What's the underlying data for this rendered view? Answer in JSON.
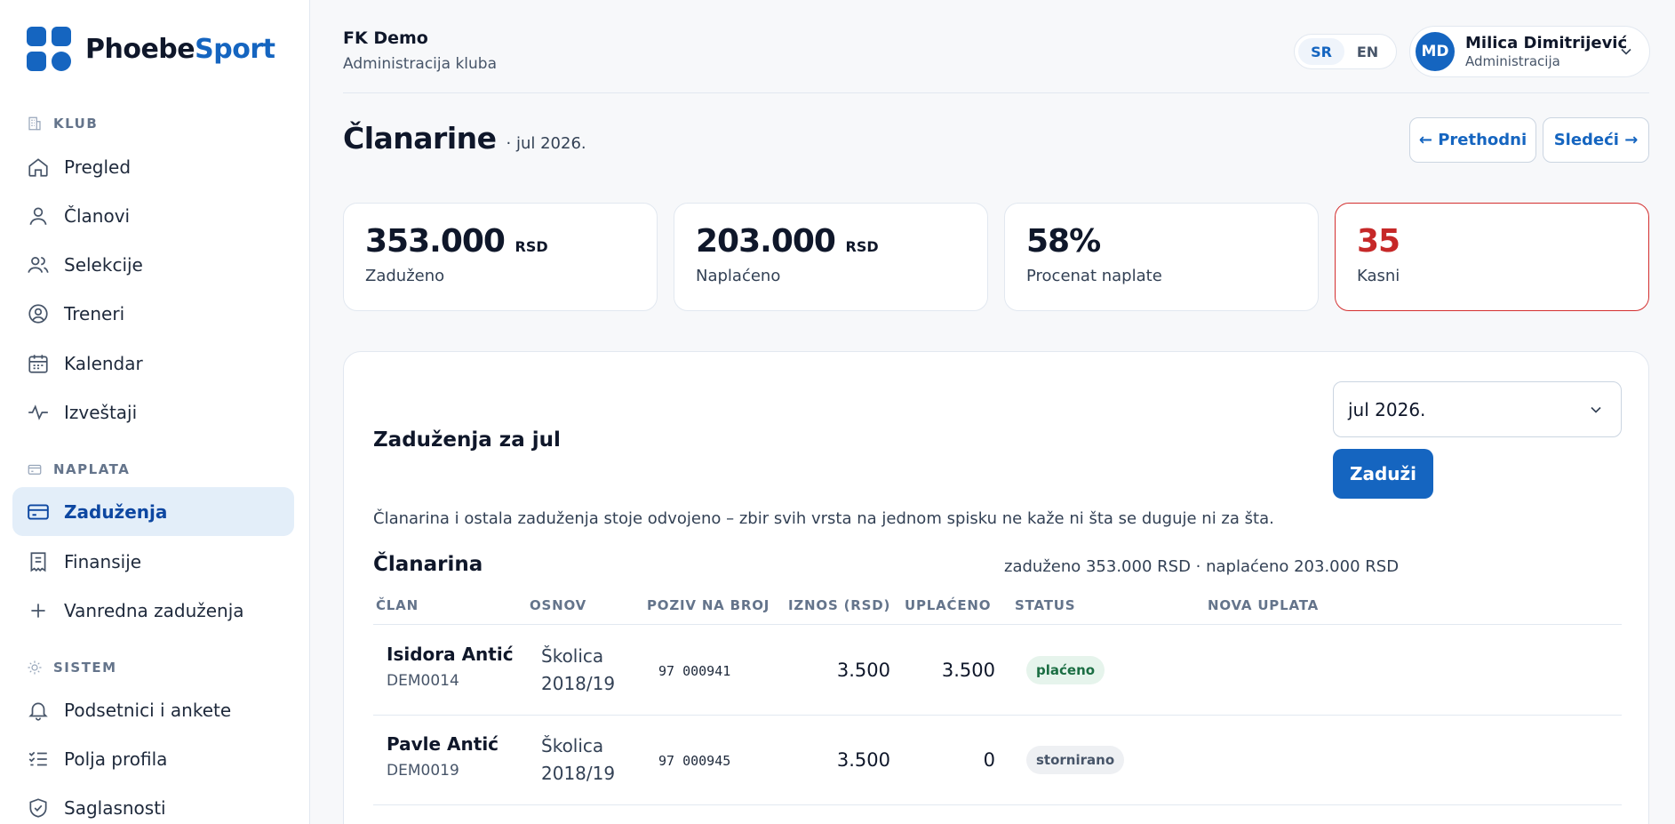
{
  "brand": {
    "name_part1": "Phoebe",
    "name_part2": "Sport",
    "color": "#1565c0"
  },
  "sidebar": {
    "sections": [
      {
        "label": "KLUB",
        "icon": "building-icon"
      },
      {
        "label": "NAPLATA",
        "icon": "wallet-icon"
      },
      {
        "label": "SISTEM",
        "icon": "sun-icon"
      }
    ],
    "items": [
      {
        "label": "Pregled",
        "icon": "home-icon"
      },
      {
        "label": "Članovi",
        "icon": "user-icon"
      },
      {
        "label": "Selekcije",
        "icon": "users-icon"
      },
      {
        "label": "Treneri",
        "icon": "user-circle-icon"
      },
      {
        "label": "Kalendar",
        "icon": "calendar-icon"
      },
      {
        "label": "Izveštaji",
        "icon": "activity-icon"
      },
      {
        "label": "Zaduženja",
        "icon": "credit-card-icon",
        "active": true
      },
      {
        "label": "Finansije",
        "icon": "receipt-icon"
      },
      {
        "label": "Vanredna zaduženja",
        "icon": "plus-icon"
      },
      {
        "label": "Podsetnici i ankete",
        "icon": "bell-icon"
      },
      {
        "label": "Polja profila",
        "icon": "checklist-icon"
      },
      {
        "label": "Saglasnosti",
        "icon": "shield-check-icon"
      }
    ]
  },
  "header": {
    "org_name": "FK Demo",
    "org_sub": "Administracija kluba",
    "languages": [
      "SR",
      "EN"
    ],
    "active_language": "SR",
    "user": {
      "initials": "MD",
      "name": "Milica Dimitrijević",
      "role": "Administracija"
    }
  },
  "page": {
    "title": "Članarine",
    "title_sub": "· jul 2026.",
    "prev_label": "← Prethodni",
    "next_label": "Sledeći →"
  },
  "stats": [
    {
      "value": "353.000",
      "unit": "RSD",
      "label": "Zaduženo"
    },
    {
      "value": "203.000",
      "unit": "RSD",
      "label": "Naplaćeno"
    },
    {
      "value": "58%",
      "unit": "",
      "label": "Procenat naplate"
    },
    {
      "value": "35",
      "unit": "",
      "label": "Kasni",
      "status_color": "#c62828"
    }
  ],
  "panel": {
    "title": "Zaduženja za jul",
    "month_selected": "jul 2026.",
    "charge_button": "Zaduži",
    "note": "Članarina i ostala zaduženja stoje odvojeno – zbir svih vrsta na jednom spisku ne kaže ni šta se duguje ni za šta.",
    "section_title": "Članarina",
    "section_summary": "zaduženo 353.000 RSD · naplaćeno 203.000 RSD",
    "columns": [
      "ČLAN",
      "OSNOV",
      "POZIV NA BROJ",
      "IZNOS (RSD)",
      "UPLAĆENO",
      "STATUS",
      "NOVA UPLATA"
    ],
    "rows": [
      {
        "name": "Isidora Antić",
        "id": "DEM0014",
        "basis": "Školica 2018/19",
        "ref": "97 000941",
        "amount": "3.500",
        "paid": "3.500",
        "status": "plaćeno",
        "status_kind": "paid"
      },
      {
        "name": "Pavle Antić",
        "id": "DEM0019",
        "basis": "Školica 2018/19",
        "ref": "97 000945",
        "amount": "3.500",
        "paid": "0",
        "status": "stornirano",
        "status_kind": "void"
      }
    ]
  }
}
